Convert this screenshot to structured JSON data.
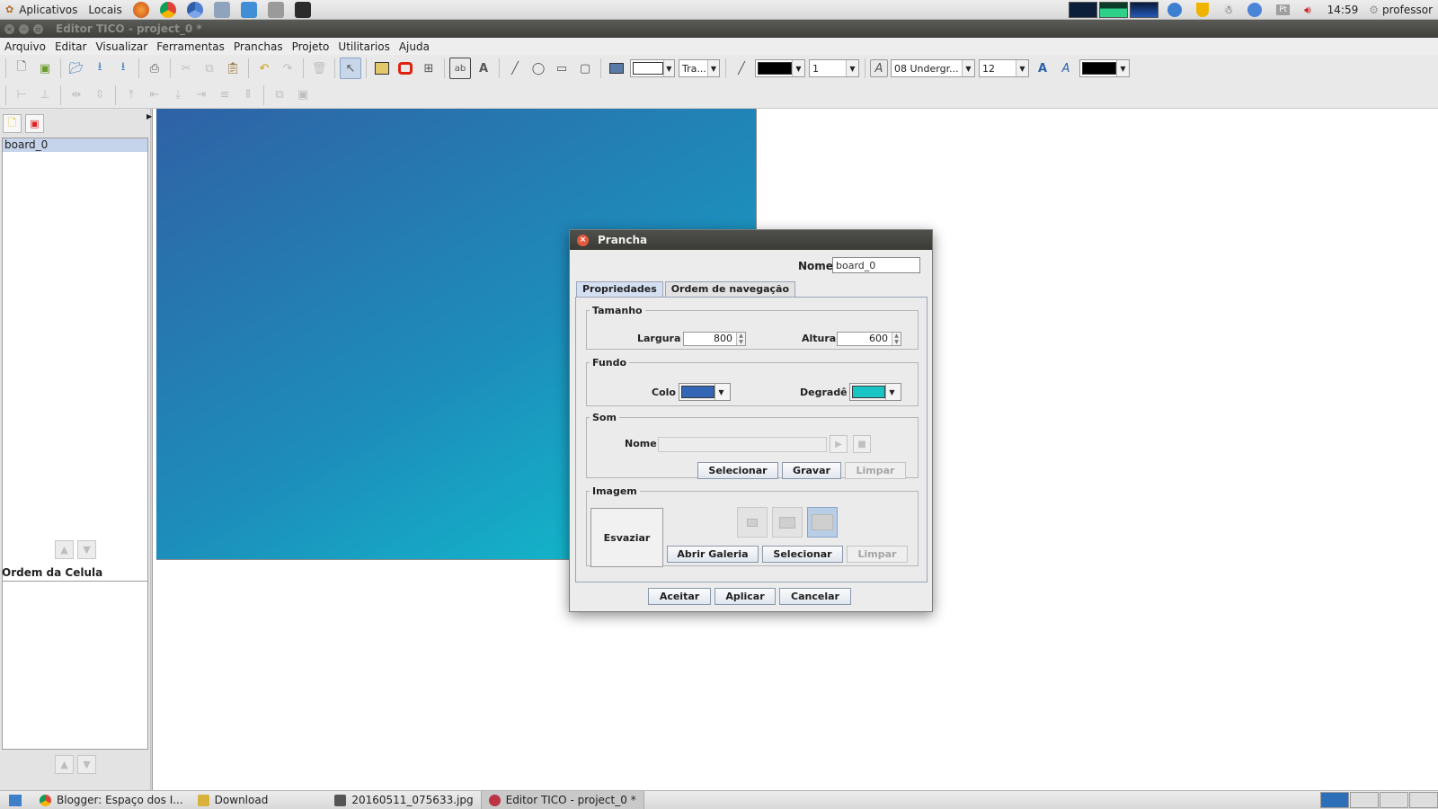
{
  "top_panel": {
    "applications_label": "Aplicativos",
    "places_label": "Locais",
    "launchers": [
      "firefox-icon",
      "chrome-icon",
      "chromium-icon",
      "settings-icon",
      "mail-icon",
      "cdra-icon",
      "terminal-icon"
    ],
    "clock": "14:59",
    "language": "Pt",
    "user": "professor"
  },
  "window": {
    "title": "Editor TICO - project_0 *"
  },
  "menu": [
    "Arquivo",
    "Editar",
    "Visualizar",
    "Ferramentas",
    "Pranchas",
    "Projeto",
    "Utilitarios",
    "Ajuda"
  ],
  "toolbar": {
    "line_style_value": "Tra...",
    "line_width_value": "1",
    "font_value": "08 Undergr...",
    "font_size_value": "12",
    "line_color": "#000000",
    "text_color": "#000000"
  },
  "left_panel": {
    "boards": [
      "board_0"
    ],
    "cell_order_label": "Ordem da Celula"
  },
  "board": {
    "gradient_start": "#2f62a6",
    "gradient_end": "#0fc3cf"
  },
  "dialog": {
    "title": "Prancha",
    "name_label": "Nome",
    "name_value": "board_0",
    "tabs": [
      "Propriedades",
      "Ordem de navegação"
    ],
    "tamanho": {
      "legend": "Tamanho",
      "width_label": "Largura",
      "width_value": "800",
      "height_label": "Altura",
      "height_value": "600"
    },
    "fundo": {
      "legend": "Fundo",
      "color_label": "Colo",
      "color_value": "#3366b4",
      "gradient_label": "Degradê",
      "gradient_value": "#19c4c4"
    },
    "som": {
      "legend": "Som",
      "name_label": "Nome",
      "name_value": "",
      "select_label": "Selecionar",
      "record_label": "Gravar",
      "clear_label": "Limpar"
    },
    "imagem": {
      "legend": "Imagem",
      "empty_label": "Esvaziar",
      "gallery_label": "Abrir Galeria",
      "select_label": "Selecionar",
      "clear_label": "Limpar"
    },
    "accept_label": "Aceitar",
    "apply_label": "Aplicar",
    "cancel_label": "Cancelar"
  },
  "taskbar": [
    {
      "label": "Blogger: Espaço dos I...",
      "icon": "chrome-icon"
    },
    {
      "label": "Download",
      "icon": "folder-icon"
    },
    {
      "label": "20160511_075633.jpg",
      "icon": "image-icon"
    },
    {
      "label": "Editor TICO - project_0 *",
      "icon": "tico-icon"
    }
  ]
}
